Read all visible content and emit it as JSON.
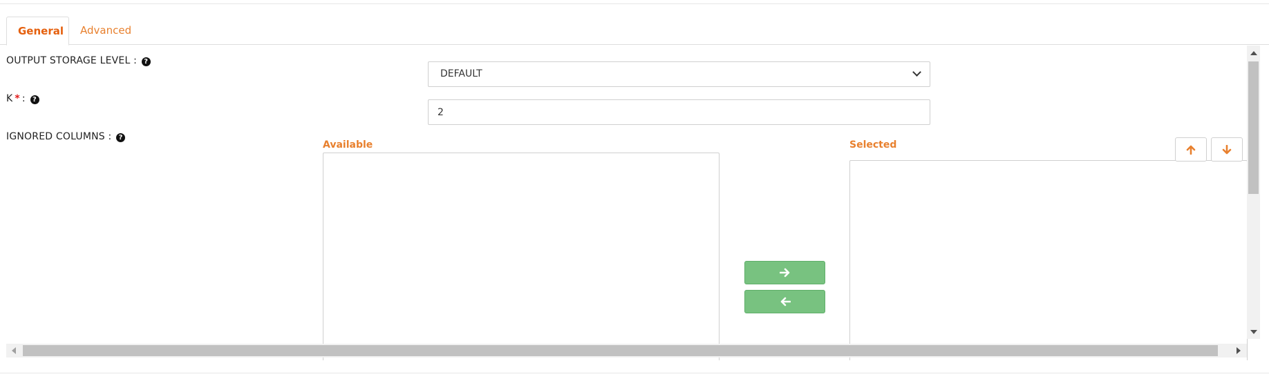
{
  "tabs": [
    {
      "label": "General",
      "active": true
    },
    {
      "label": "Advanced",
      "active": false
    }
  ],
  "form": {
    "output_storage_level": {
      "label": "OUTPUT STORAGE LEVEL :",
      "value": "DEFAULT"
    },
    "k": {
      "label": "K",
      "required_mark": "*",
      "suffix": ":",
      "value": "2"
    },
    "ignored_columns": {
      "label": "IGNORED COLUMNS :",
      "available_heading": "Available",
      "selected_heading": "Selected"
    }
  },
  "icons": {
    "help": "question-circle-icon",
    "move_right": "arrow-right-icon",
    "move_left": "arrow-left-icon",
    "move_up": "arrow-up-icon",
    "move_down": "arrow-down-icon"
  },
  "colors": {
    "accent_orange": "#e8802e",
    "move_button_green": "#78c280",
    "required_red": "#e21b1b"
  }
}
